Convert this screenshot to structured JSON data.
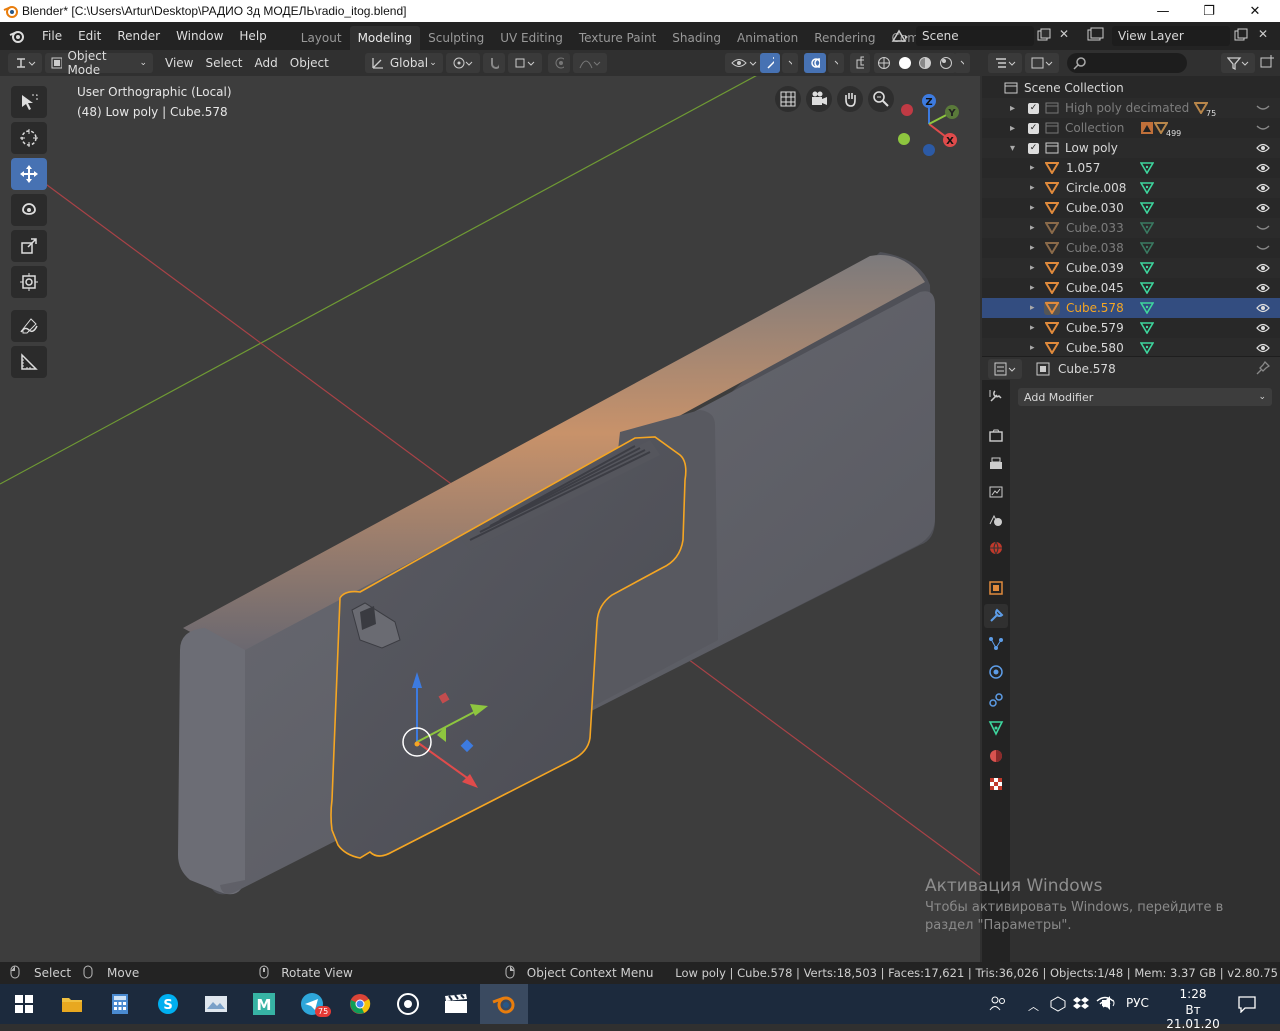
{
  "window": {
    "title": "Blender* [C:\\Users\\Artur\\Desktop\\РАДИО 3д МОДЕЛЬ\\radio_itog.blend]",
    "minimize": "—",
    "maximize": "❐",
    "close": "✕"
  },
  "menu": [
    "File",
    "Edit",
    "Render",
    "Window",
    "Help"
  ],
  "workspaces": [
    {
      "label": "Layout",
      "active": false
    },
    {
      "label": "Modeling",
      "active": true
    },
    {
      "label": "Sculpting",
      "active": false
    },
    {
      "label": "UV Editing",
      "active": false
    },
    {
      "label": "Texture Paint",
      "active": false
    },
    {
      "label": "Shading",
      "active": false
    },
    {
      "label": "Animation",
      "active": false
    },
    {
      "label": "Rendering",
      "active": false
    },
    {
      "label": "Compositing",
      "active": false
    }
  ],
  "scene": {
    "label": "Scene"
  },
  "view_layer": {
    "label": "View Layer"
  },
  "header": {
    "mode": "Object Mode",
    "view": "View",
    "select": "Select",
    "add": "Add",
    "object": "Object",
    "orientation": "Global"
  },
  "viewport": {
    "view_name": "User Orthographic (Local)",
    "info": "(48) Low poly | Cube.578",
    "gizmo_axes": {
      "x": "X",
      "y": "Y",
      "z": "Z"
    }
  },
  "outliner": {
    "root": "Scene Collection",
    "collections": [
      {
        "label": "High poly decimated",
        "badge": "75",
        "dim": true
      },
      {
        "label": "Collection",
        "badge": "499",
        "dim": true
      },
      {
        "label": "Low poly",
        "dim": false
      }
    ],
    "objects": [
      {
        "label": "1.057",
        "dim": false,
        "selected": false
      },
      {
        "label": "Circle.008",
        "dim": false,
        "selected": false
      },
      {
        "label": "Cube.030",
        "dim": false,
        "selected": false
      },
      {
        "label": "Cube.033",
        "dim": true,
        "selected": false
      },
      {
        "label": "Cube.038",
        "dim": true,
        "selected": false
      },
      {
        "label": "Cube.039",
        "dim": false,
        "selected": false
      },
      {
        "label": "Cube.045",
        "dim": false,
        "selected": false
      },
      {
        "label": "Cube.578",
        "dim": false,
        "selected": true
      },
      {
        "label": "Cube.579",
        "dim": false,
        "selected": false
      },
      {
        "label": "Cube.580",
        "dim": false,
        "selected": false
      }
    ]
  },
  "properties": {
    "object_name": "Cube.578",
    "add_modifier": "Add Modifier"
  },
  "status": {
    "select": "Select",
    "move": "Move",
    "rotate": "Rotate View",
    "context": "Object Context Menu",
    "stats": "Low poly | Cube.578 | Verts:18,503 | Faces:17,621 | Tris:36,026 | Objects:1/48 | Mem: 3.37 GB | v2.80.75"
  },
  "watermark": {
    "title": "Активация Windows",
    "line1": "Чтобы активировать Windows, перейдите в",
    "line2": "раздел \"Параметры\"."
  },
  "taskbar": {
    "telegram_badge": "75",
    "lang": "РУС",
    "time": "1:28",
    "date": "Вт 21.01.20"
  },
  "colors": {
    "accent": "#4772b3",
    "selection_orange": "#f5a623",
    "mesh_triangle": "#e08a3c",
    "mesh_data_green": "#3ed69e"
  }
}
